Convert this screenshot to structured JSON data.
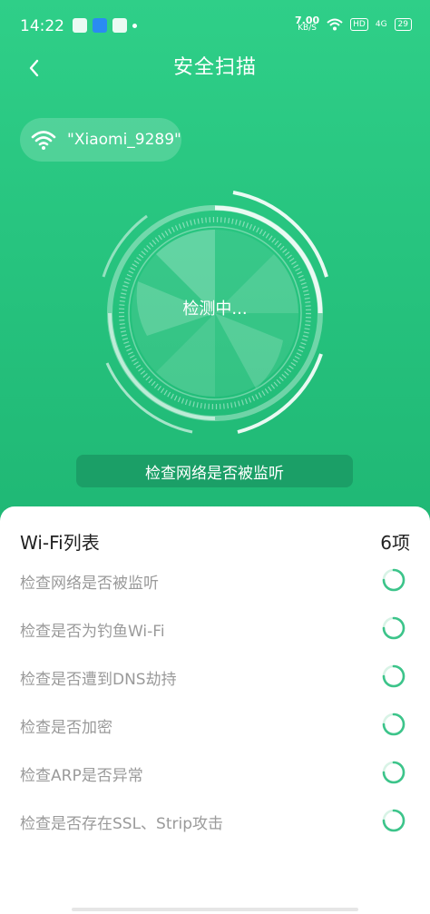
{
  "status_bar": {
    "time": "14:22",
    "speed_value": "7.00",
    "speed_unit": "KB/S",
    "hd": "HD",
    "signal": "4G",
    "battery": "29"
  },
  "header": {
    "title": "安全扫描",
    "back_icon": "chevron-left-icon"
  },
  "network": {
    "ssid": "\"Xiaomi_9289\"",
    "icon": "wifi-icon"
  },
  "scanner": {
    "status": "检测中...",
    "current_check": "检查网络是否被监听"
  },
  "list": {
    "title": "Wi-Fi列表",
    "count": "6项",
    "items": [
      {
        "label": "检查网络是否被监听"
      },
      {
        "label": "检查是否为钓鱼Wi-Fi"
      },
      {
        "label": "检查是否遭到DNS劫持"
      },
      {
        "label": "检查是否加密"
      },
      {
        "label": "检查ARP是否异常"
      },
      {
        "label": "检查是否存在SSL、Strip攻击"
      }
    ]
  },
  "colors": {
    "primary": "#27c47f",
    "dark": "#1b9f67",
    "spinner": "#3cc48a"
  }
}
